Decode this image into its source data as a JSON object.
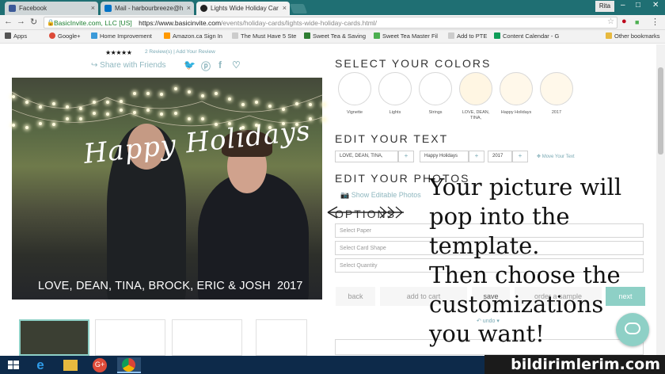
{
  "browser": {
    "tabs": [
      {
        "label": "Facebook",
        "color": "#3b5998"
      },
      {
        "label": "Mail - harbourbreeze@h",
        "color": "#0072c6"
      },
      {
        "label": "Lights Wide Holiday Car",
        "color": "#222222"
      }
    ],
    "user_label": "Rita",
    "secure_label": "BasicInvite.com, LLC [US]",
    "url_host": "https://www.basicinvite.com",
    "url_path": "/events/holiday-cards/lights-wide-holiday-cards.html/",
    "bookmarks": [
      {
        "label": "Apps",
        "color": "#555555"
      },
      {
        "label": "Google+",
        "color": "#dd4b39"
      },
      {
        "label": "Home Improvement",
        "color": "#3b9ad9"
      },
      {
        "label": "Amazon.ca Sign In",
        "color": "#ff9900"
      },
      {
        "label": "The Must Have 5 Ste",
        "color": "#cccccc"
      },
      {
        "label": "Sweet Tea & Saving",
        "color": "#2e7d32"
      },
      {
        "label": "Sweet Tea Master Fil",
        "color": "#4caf50"
      },
      {
        "label": "Add to PTE",
        "color": "#cccccc"
      },
      {
        "label": "Content Calendar - G",
        "color": "#0f9d58"
      }
    ],
    "other_bookmarks": "Other bookmarks"
  },
  "product": {
    "stars": "★★★★★",
    "reviews": "2 Review(s)  |  Add Your Review",
    "share_label": "Share with Friends",
    "card_title": "Happy Holidays",
    "card_names": "LOVE, DEAN, TINA, BROCK, ERIC & JOSH",
    "card_year": "2017"
  },
  "colors_section": {
    "title": "SELECT YOUR COLORS",
    "swatches": [
      {
        "label": "Vignette",
        "color": "#ffffff"
      },
      {
        "label": "Lights",
        "color": "#ffffff"
      },
      {
        "label": "Strings",
        "color": "#ffffff"
      },
      {
        "label": "LOVE, DEAN, TINA,",
        "color": "#fff6e3"
      },
      {
        "label": "Happy Holidays",
        "color": "#fff8ea"
      },
      {
        "label": "2017",
        "color": "#fff8ea"
      }
    ]
  },
  "text_section": {
    "title": "EDIT YOUR TEXT",
    "fields": [
      "LOVE, DEAN, TINA,",
      "Happy Holidays",
      "2017"
    ],
    "plus": "+",
    "move_text": "✥ Move Your Text"
  },
  "photos_section": {
    "title": "EDIT YOUR PHOTOS",
    "show_photos": "Show Editable Photos"
  },
  "options_section": {
    "title": "OPTIONS",
    "selects": [
      "Select Paper",
      "Select Card Shape",
      "Select Quantity"
    ]
  },
  "actions": {
    "back": "back",
    "add_to_cart": "add to cart",
    "save": "save",
    "order_sample": "order a sample",
    "next": "next",
    "undo": "↶ undo ▾"
  },
  "annotation": {
    "lines": [
      "Your picture will",
      "pop into the",
      "template.",
      "Then choose the",
      "customizations",
      "you want!"
    ]
  },
  "watermark": "bildirimlerim.com"
}
